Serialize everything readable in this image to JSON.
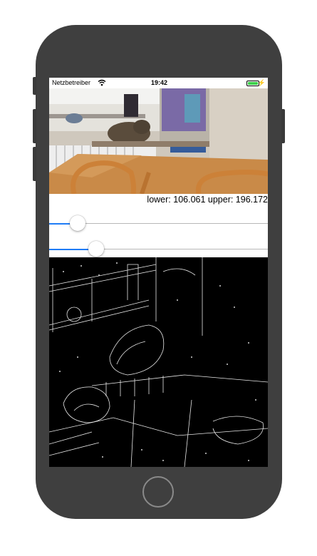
{
  "status_bar": {
    "carrier": "Netzbetreiber",
    "time": "19:42",
    "battery_level": 1.0,
    "wifi_icon": "wifi-icon",
    "charging_icon": "charging-bolt-icon"
  },
  "threshold_label": "lower: 106.061 upper: 196.172",
  "sliders": {
    "lower": {
      "fraction": 0.13
    },
    "upper": {
      "fraction": 0.215
    }
  },
  "colors": {
    "accent": "#1f7cf6",
    "phone_body": "#3f3f3f",
    "battery": "#3cd04a"
  }
}
